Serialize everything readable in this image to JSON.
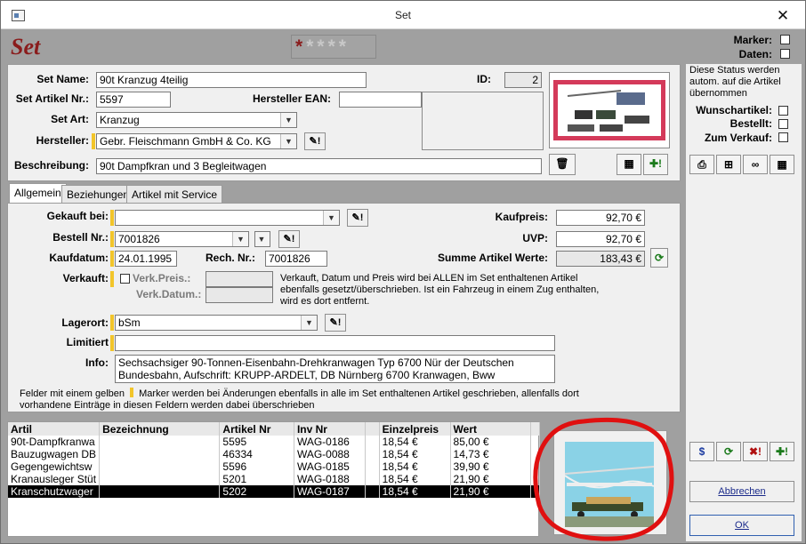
{
  "window": {
    "title": "Set"
  },
  "header": {
    "big_title": "Set",
    "stars": "*****"
  },
  "status": {
    "marker_label": "Marker:",
    "daten_label": "Daten:",
    "note": "Diese Status werden autom. auf die Artikel übernommen",
    "wunsch_label": "Wunschartikel:",
    "bestellt_label": "Bestellt:",
    "verkauf_label": "Zum Verkauf:"
  },
  "form": {
    "set_name_label": "Set Name:",
    "set_name": "90t Kranzug 4teilig",
    "id_label": "ID:",
    "id": "2",
    "set_artikel_label": "Set Artikel Nr.:",
    "set_artikel": "5597",
    "hersteller_ean_label": "Hersteller EAN:",
    "hersteller_ean": "",
    "set_art_label": "Set Art:",
    "set_art": "Kranzug",
    "hersteller_label": "Hersteller:",
    "hersteller": "Gebr. Fleischmann GmbH & Co. KG",
    "beschreibung_label": "Beschreibung:",
    "beschreibung": "90t Dampfkran und 3 Begleitwagen"
  },
  "tabs": {
    "allgemein": "Allgemein",
    "beziehungen": "Beziehungen",
    "artikel_service": "Artikel mit Service"
  },
  "allgemein": {
    "gekauft_label": "Gekauft bei:",
    "gekauft": "",
    "bestell_label": "Bestell Nr.:",
    "bestell": "7001826",
    "kaufdatum_label": "Kaufdatum:",
    "kaufdatum": "24.01.1995",
    "rech_label": "Rech. Nr.:",
    "rech": "7001826",
    "verkauft_label": "Verkauft:",
    "verk_preis_label": "Verk.Preis.:",
    "verk_datum_label": "Verk.Datum.:",
    "verkauft_note": "Verkauft, Datum und Preis wird bei ALLEN im Set enthaltenen Artikel ebenfalls gesetzt/überschrieben. Ist ein Fahrzeug in einem Zug enthalten, wird es dort entfernt.",
    "kaufpreis_label": "Kaufpreis:",
    "kaufpreis": "92,70 €",
    "uvp_label": "UVP:",
    "uvp": "92,70 €",
    "summe_label": "Summe Artikel Werte:",
    "summe": "183,43 €",
    "lagerort_label": "Lagerort:",
    "lagerort": "bSm",
    "limitiert_label": "Limitiert",
    "limitiert": "",
    "info_label": "Info:",
    "info_line1": "Sechsachsiger 90-Tonnen-Eisenbahn-Drehkranwagen Typ 6700 Nür der Deutschen",
    "info_line2": "Bundesbahn, Aufschrift: KRUPP-ARDELT, DB Nürnberg 6700 Kranwagen, Bww",
    "footnote1": "Felder mit einem gelben",
    "footnote2": "Marker werden bei Änderungen ebenfalls in alle im Set enthaltenen Artikel geschrieben, allenfalls dort",
    "footnote3": "vorhandene Einträge in diesen Feldern werden dabei überschrieben"
  },
  "grid": {
    "headers": [
      "Artil",
      "Bezeichnung",
      "Artikel Nr",
      "Inv Nr",
      "",
      "Einzelpreis",
      "Wert",
      ""
    ],
    "rows": [
      [
        "90t-Dampfkranwa",
        "",
        "5595",
        "WAG-0186",
        "",
        "18,54 €",
        "85,00 €",
        ""
      ],
      [
        "Bauzugwagen DB",
        "",
        "46334",
        "WAG-0088",
        "",
        "18,54 €",
        "14,73 €",
        ""
      ],
      [
        "Gegengewichtsw",
        "",
        "5596",
        "WAG-0185",
        "",
        "18,54 €",
        "39,90 €",
        ""
      ],
      [
        "Kranausleger Stüt",
        "",
        "5201",
        "WAG-0188",
        "",
        "18,54 €",
        "21,90 €",
        ""
      ],
      [
        "Kranschutzwager",
        "",
        "5202",
        "WAG-0187",
        "",
        "18,54 €",
        "21,90 €",
        ""
      ]
    ]
  },
  "buttons": {
    "abbrechen": "Abbrechen",
    "ok": "OK"
  },
  "colors": {
    "title_red": "#8a1c1c",
    "marker_yellow": "#f2c52a",
    "annotation_red": "#e01010"
  }
}
